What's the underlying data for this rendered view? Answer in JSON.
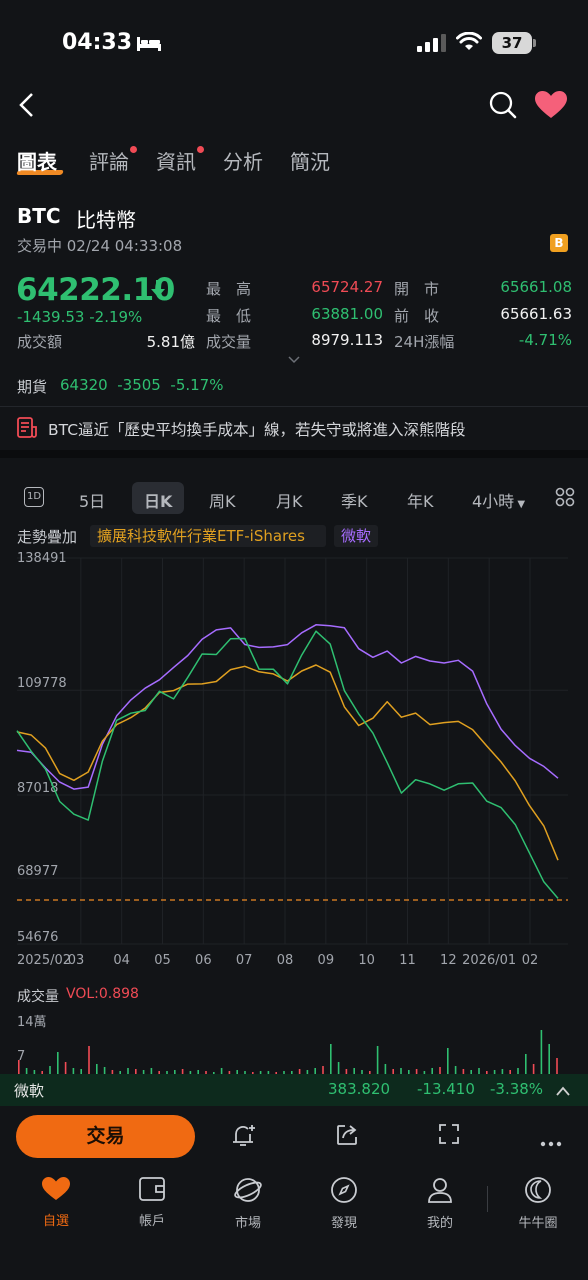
{
  "status_bar": {
    "time": "04:33",
    "battery": "37"
  },
  "tabs": [
    {
      "label": "圖表",
      "active": true,
      "dot": false
    },
    {
      "label": "評論",
      "active": false,
      "dot": true
    },
    {
      "label": "資訊",
      "active": false,
      "dot": true
    },
    {
      "label": "分析",
      "active": false,
      "dot": false
    },
    {
      "label": "簡況",
      "active": false,
      "dot": false
    }
  ],
  "stock": {
    "code": "BTC",
    "name": "比特幣",
    "status": "交易中 02/24 04:33:08",
    "badge": "B",
    "price": "64222.10",
    "change": "-1439.53",
    "change_pct": "-2.19%",
    "turnover_label": "成交額",
    "turnover": "5.81億"
  },
  "stats": {
    "high_label": "最　高",
    "high": "65724.27",
    "low_label": "最　低",
    "low": "63881.00",
    "volume_label": "成交量",
    "volume": "8979.113",
    "open_label": "開　市",
    "open": "65661.08",
    "prev_close_label": "前　收",
    "prev_close": "65661.63",
    "change24h_label": "24H漲幅",
    "change24h": "-4.71%"
  },
  "futures": {
    "label": "期貨",
    "price": "64320",
    "change": "-3505",
    "pct": "-5.17%"
  },
  "news": {
    "text": "BTC逼近「歷史平均換手成本」線，若失守或將進入深熊階段"
  },
  "periods": [
    "5日",
    "日K",
    "周K",
    "月K",
    "季K",
    "年K",
    "4小時"
  ],
  "active_period": "日K",
  "overlay": {
    "label": "走勢疊加",
    "series1": "擴展科技軟件行業ETF-iShares",
    "series2": "微軟"
  },
  "colors": {
    "btc": "#2fbf71",
    "etf": "#e0a020",
    "msft": "#a66cff",
    "up": "#f04b55",
    "down": "#2fbf71",
    "accent": "#f06a12"
  },
  "chart_data": {
    "type": "line",
    "y_ticks": [
      "138491",
      "109778",
      "87018",
      "68977",
      "54676"
    ],
    "x_ticks": [
      "2025/02",
      "03",
      "04",
      "05",
      "06",
      "07",
      "08",
      "09",
      "10",
      "11",
      "12",
      "2026/01",
      "02"
    ],
    "reference_line": 64222.1,
    "ylim": [
      54676,
      138491
    ],
    "series": [
      {
        "name": "BTC",
        "color": "#2fbf71",
        "values": [
          101000,
          97000,
          92000,
          86000,
          83000,
          81000,
          95000,
          103000,
          104500,
          106000,
          109000,
          108000,
          113000,
          117000,
          118000,
          121000,
          120500,
          115000,
          114000,
          111000,
          118000,
          122000,
          120000,
          110000,
          104000,
          101000,
          94000,
          87000,
          91000,
          89000,
          88000,
          90000,
          89000,
          86000,
          84500,
          80000,
          75000,
          68000,
          64222
        ]
      },
      {
        "name": "擴展科技軟件行業ETF-iShares",
        "color": "#e0a020",
        "values": [
          101000,
          100000,
          97000,
          92000,
          90000,
          92000,
          99000,
          102000,
          104000,
          106000,
          109000,
          110000,
          111000,
          111000,
          112000,
          114000,
          115000,
          114000,
          113000,
          112000,
          114000,
          115000,
          114000,
          106000,
          102000,
          104000,
          107000,
          104000,
          105000,
          102000,
          103000,
          103000,
          101000,
          98000,
          94000,
          90000,
          85000,
          80000,
          73000
        ]
      },
      {
        "name": "微軟",
        "color": "#a66cff",
        "values": [
          97000,
          96000,
          93000,
          90000,
          88000,
          89000,
          98000,
          104000,
          108000,
          110000,
          112000,
          115000,
          117000,
          121000,
          123000,
          123000,
          120000,
          119000,
          119000,
          120000,
          122000,
          124000,
          124000,
          123000,
          119000,
          117000,
          118000,
          116000,
          117000,
          116000,
          116000,
          116000,
          114000,
          107000,
          101000,
          98000,
          95000,
          93000,
          91000
        ]
      }
    ]
  },
  "volume": {
    "label": "成交量",
    "value": "VOL:0.898",
    "ticks": [
      "14萬",
      "7"
    ]
  },
  "quote_bar": {
    "name": "微軟",
    "price": "383.820",
    "change": "-13.410",
    "pct": "-3.38%"
  },
  "trade_button": "交易",
  "bottom_nav": [
    {
      "label": "自選",
      "active": true
    },
    {
      "label": "帳戶",
      "active": false
    },
    {
      "label": "市場",
      "active": false
    },
    {
      "label": "發現",
      "active": false
    },
    {
      "label": "我的",
      "active": false
    },
    {
      "label": "牛牛圈",
      "active": false
    }
  ]
}
